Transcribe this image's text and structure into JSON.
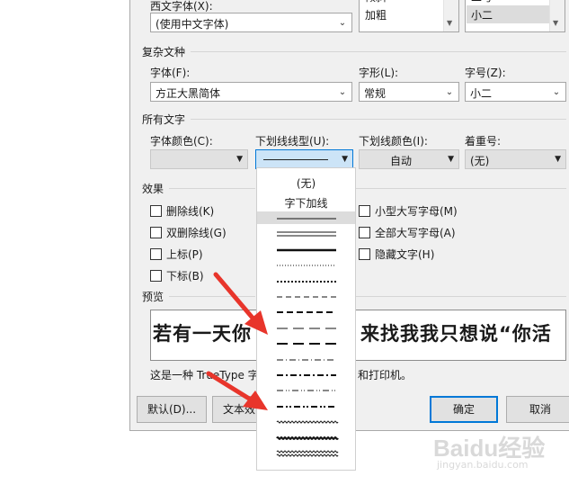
{
  "top": {
    "western_font_label": "西文字体(X):",
    "western_font_value": "(使用中文字体)",
    "style_list": [
      "倾斜",
      "加粗"
    ],
    "size_list": [
      "二号",
      "小二"
    ]
  },
  "complex": {
    "section_title": "复杂文种",
    "font_label": "字体(F):",
    "font_value": "方正大黑简体",
    "style_label": "字形(L):",
    "style_value": "常规",
    "size_label": "字号(Z):",
    "size_value": "小二"
  },
  "all_text": {
    "section_title": "所有文字",
    "color_label": "字体颜色(C):",
    "underline_label": "下划线线型(U):",
    "underline_color_label": "下划线颜色(I):",
    "underline_color_value": "自动",
    "emphasis_label": "着重号:",
    "emphasis_value": "(无)"
  },
  "effects": {
    "section_title": "效果",
    "strikethrough": "删除线(K)",
    "double_strikethrough": "双删除线(G)",
    "superscript": "上标(P)",
    "subscript": "下标(B)",
    "small_caps": "小型大写字母(M)",
    "all_caps": "全部大写字母(A)",
    "hidden": "隐藏文字(H)"
  },
  "preview": {
    "section_title": "预览",
    "sample": "若有一天你",
    "sample_tail": "来找我我只想说“你活",
    "note_left": "这是一种 TrueType 字",
    "note_right": "和打印机。"
  },
  "buttons": {
    "default": "默认(D)...",
    "text_effect": "文本效",
    "ok": "确定",
    "cancel": "取消"
  },
  "underline_popup": {
    "none": "(无)",
    "words_only": "字下加线",
    "styles": [
      "single",
      "double",
      "thick",
      "dotted",
      "dotted-heavy",
      "dashed",
      "dashed-heavy",
      "long-dash",
      "long-dash-heavy",
      "dot-dash",
      "dot-dash-heavy",
      "dot-dot-dash",
      "dot-dot-dash-heavy",
      "wave",
      "wave-heavy",
      "wave-double"
    ]
  },
  "watermark": {
    "brand": "Baidu经验",
    "url": "jingyan.baidu.com"
  },
  "colors": {
    "dialog_bg": "#f0f0f0",
    "accent": "#0078d7",
    "arrow_red": "#e8352b"
  }
}
